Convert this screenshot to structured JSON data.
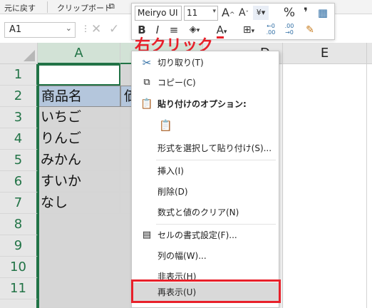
{
  "ribbon": {
    "undo": "元に戻す",
    "clipboard": "クリップボード",
    "launcher": "⧉"
  },
  "namebox": {
    "value": "A1",
    "dropdown": "⌄"
  },
  "formula_bar": {
    "dots": "⋮",
    "cancel": "✕",
    "enter": "✓"
  },
  "columns": [
    "A",
    "D",
    "E"
  ],
  "rows": [
    "1",
    "2",
    "3",
    "4",
    "5",
    "6",
    "7",
    "8",
    "9",
    "10",
    "11"
  ],
  "cells": {
    "header": "商品名",
    "header_next": "価",
    "items": [
      "いちご",
      "りんご",
      "みかん",
      "すいか",
      "なし"
    ]
  },
  "mini_toolbar": {
    "font": "Meiryo UI",
    "size": "11",
    "grow": "A^",
    "shrink": "Aˇ",
    "percent": "%",
    "comma": "❜",
    "bold": "B",
    "italic": "I",
    "align": "≡",
    "font_color_letter": "A",
    "dec_inc": "←0\n.00",
    "dec_dec": ".00\n→0"
  },
  "annotation": "右クリック",
  "menu": {
    "items": [
      {
        "label": "切り取り(T)",
        "icon": "scissors-icon"
      },
      {
        "label": "コピー(C)",
        "icon": "copy-icon"
      },
      {
        "label": "貼り付けのオプション:",
        "icon": "paste-icon"
      },
      {
        "label": "形式を選択して貼り付け(S)...",
        "icon": ""
      },
      {
        "label": "挿入(I)",
        "icon": ""
      },
      {
        "label": "削除(D)",
        "icon": ""
      },
      {
        "label": "数式と値のクリア(N)",
        "icon": ""
      },
      {
        "label": "セルの書式設定(F)...",
        "icon": "format-cells-icon"
      },
      {
        "label": "列の幅(W)...",
        "icon": ""
      },
      {
        "label": "非表示(H)",
        "icon": ""
      },
      {
        "label": "再表示(U)",
        "icon": ""
      }
    ]
  },
  "colors": {
    "accent": "#217346",
    "annotation": "#e8202a",
    "header_fill": "#b4c6dc"
  }
}
